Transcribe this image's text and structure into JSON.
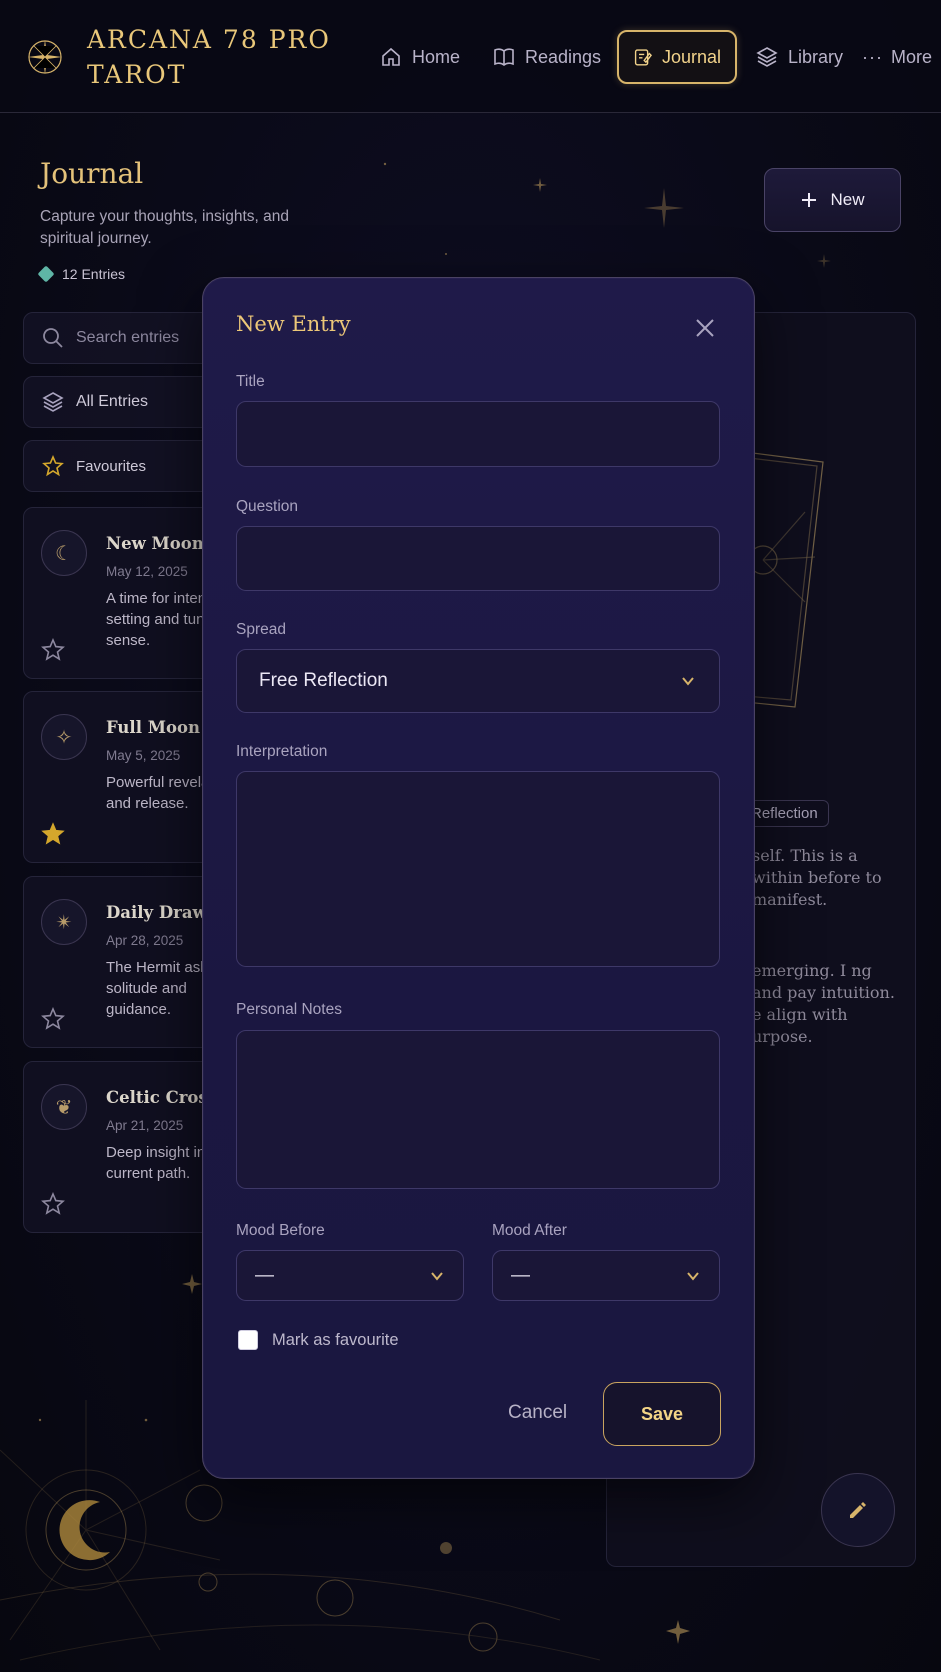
{
  "header": {
    "brand": "ARCANA 78 PRO TAROT",
    "nav": [
      {
        "label": "Home",
        "icon": "home-icon"
      },
      {
        "label": "Readings",
        "icon": "book-icon"
      },
      {
        "label": "Journal",
        "icon": "journal-icon",
        "active": true
      },
      {
        "label": "Library",
        "icon": "layers-icon"
      },
      {
        "label": "More",
        "icon": "more-dots-icon"
      }
    ]
  },
  "page": {
    "title": "Journal",
    "subtitle": "Capture your thoughts, insights, and spiritual journey.",
    "entries_count": "12 Entries",
    "new_button": "New"
  },
  "sidebar": {
    "search_placeholder": "Search entries",
    "filters": [
      {
        "label": "All Entries",
        "icon": "layers-icon"
      },
      {
        "label": "Favourites",
        "icon": "star-icon"
      }
    ]
  },
  "entries": [
    {
      "title": "New Moon Reflection",
      "date": "May 12, 2025",
      "text": "A time for intention setting and tune sense.",
      "favourite": false,
      "icon": "moon-icon"
    },
    {
      "title": "Full Moon Release",
      "date": "May 5, 2025",
      "text": "Powerful revelations and release.",
      "favourite": true,
      "icon": "sparkle-icon"
    },
    {
      "title": "Daily Draw Hermit",
      "date": "Apr 28, 2025",
      "text": "The Hermit asks for solitude and guidance.",
      "favourite": false,
      "icon": "wand-icon"
    },
    {
      "title": "Celtic Cross Spread",
      "date": "Apr 21, 2025",
      "text": "Deep insight into my current path.",
      "favourite": false,
      "icon": "lotus-icon"
    }
  ],
  "detail": {
    "tag": "Reflection",
    "paragraph1": "self. This is a within before to manifest.",
    "paragraph2": "emerging. I ng and pay intuition. e align with urpose."
  },
  "modal": {
    "title": "New Entry",
    "title_label": "Title",
    "title_value": "",
    "question_label": "Question",
    "question_value": "",
    "spread_label": "Spread",
    "spread_value": "Free Reflection",
    "interpretation_label": "Interpretation",
    "interpretation_value": "",
    "notes_label": "Personal Notes",
    "notes_value": "",
    "mood_before_label": "Mood Before",
    "mood_before_value": "—",
    "mood_after_label": "Mood After",
    "mood_after_value": "—",
    "favourite_label": "Mark as favourite",
    "favourite_checked": false,
    "cancel_label": "Cancel",
    "save_label": "Save"
  },
  "colors": {
    "accent_gold": "#e6c275",
    "background": "#0a0a18",
    "modal_bg": "#1d1946",
    "favourite_star": "#d4a72c"
  }
}
